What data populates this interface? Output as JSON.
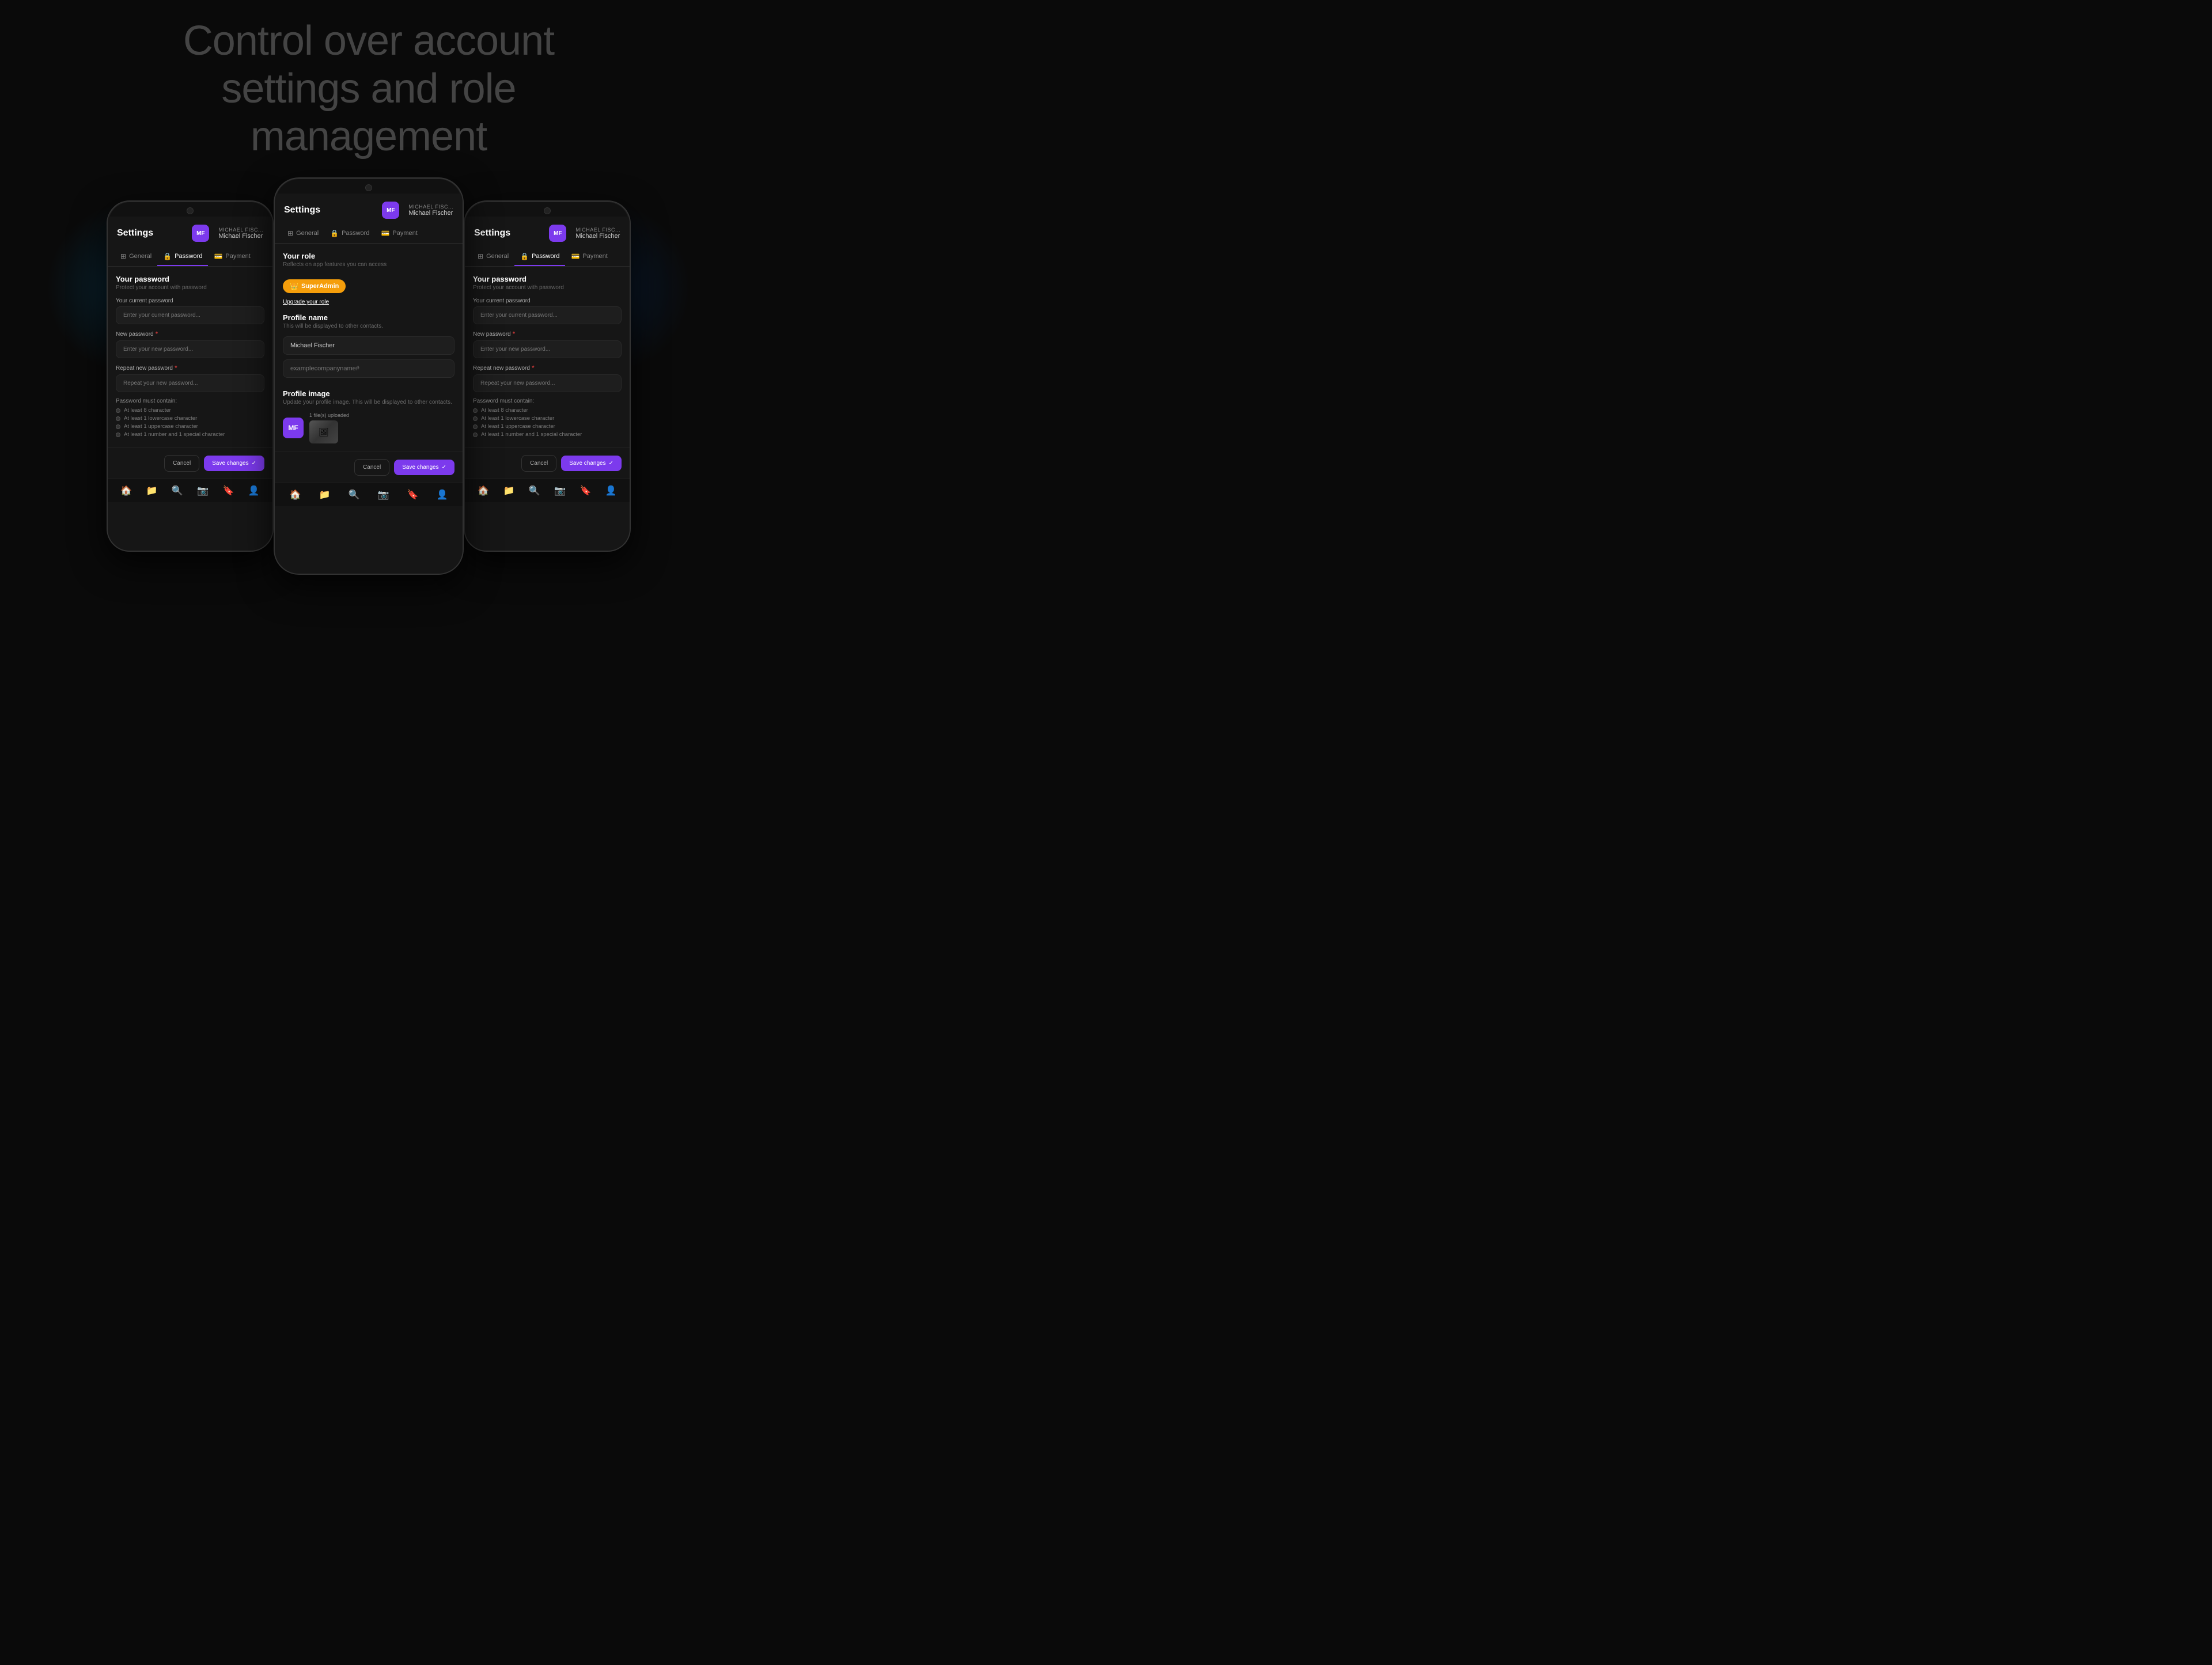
{
  "page": {
    "background": "#0a0a0a",
    "hero": {
      "line1": "Control over account",
      "line2": "settings and role",
      "line3": "management"
    }
  },
  "phones": {
    "left": {
      "header": {
        "title": "Settings",
        "avatar_initials": "MF",
        "user_name_top": "MICHAEL FISC...",
        "user_name_bottom": "Michael Fischer"
      },
      "tabs": [
        {
          "label": "General",
          "icon": "⊞",
          "active": false
        },
        {
          "label": "Password",
          "icon": "🔒",
          "active": true
        },
        {
          "label": "Payment",
          "icon": "💳",
          "active": false
        }
      ],
      "password_section": {
        "title": "Your password",
        "subtitle": "Protect your account with password",
        "fields": [
          {
            "label": "Your current password",
            "required": false,
            "placeholder": "Enter your current password..."
          },
          {
            "label": "New password",
            "required": true,
            "placeholder": "Enter your new password..."
          },
          {
            "label": "Repeat new password",
            "required": true,
            "placeholder": "Repeat your new password..."
          }
        ],
        "rules_title": "Password must contain:",
        "rules": [
          {
            "label": "At least 8 character",
            "checked": false
          },
          {
            "label": "At least 1 lowercase character",
            "checked": false
          },
          {
            "label": "At least 1 uppercase character",
            "checked": false
          },
          {
            "label": "At least 1 number and 1 special character",
            "checked": false
          }
        ]
      },
      "buttons": {
        "cancel": "Cancel",
        "save": "Save changes"
      },
      "bottom_nav": [
        "🏠",
        "📁",
        "🔍",
        "📷",
        "🔖",
        "👤"
      ]
    },
    "center": {
      "header": {
        "title": "Settings",
        "avatar_initials": "MF",
        "user_name_top": "MICHAEL FISC...",
        "user_name_bottom": "Michael Fischer"
      },
      "tabs": [
        {
          "label": "General",
          "icon": "⊞",
          "active": false
        },
        {
          "label": "Password",
          "icon": "🔒",
          "active": false
        },
        {
          "label": "Payment",
          "icon": "💳",
          "active": false
        }
      ],
      "role_section": {
        "title": "Your role",
        "subtitle": "Reflects on app features you can access",
        "role_label": "SuperAdmin",
        "upgrade_text": "Upgrade your role"
      },
      "profile_name_section": {
        "title": "Profile name",
        "subtitle": "This will be displayed to other contacts.",
        "name_value": "Michael Fischer",
        "company_placeholder": "examplecompanyname#"
      },
      "profile_image_section": {
        "title": "Profile image",
        "subtitle": "Update your profile image. This will be displayed to other contacts.",
        "files_uploaded": "1 file(s) uploaded",
        "avatar_initials": "MF"
      },
      "buttons": {
        "cancel": "Cancel",
        "save": "Save changes"
      },
      "bottom_nav": [
        "🏠",
        "📁",
        "🔍",
        "📷",
        "🔖",
        "👤"
      ]
    },
    "right": {
      "header": {
        "title": "Settings",
        "avatar_initials": "MF",
        "user_name_top": "MICHAEL FISC...",
        "user_name_bottom": "Michael Fischer"
      },
      "tabs": [
        {
          "label": "General",
          "icon": "⊞",
          "active": false
        },
        {
          "label": "Password",
          "icon": "🔒",
          "active": true
        },
        {
          "label": "Payment",
          "icon": "💳",
          "active": false
        }
      ],
      "password_section": {
        "title": "Your password",
        "subtitle": "Protect your account with password",
        "fields": [
          {
            "label": "Your current password",
            "required": false,
            "placeholder": "Enter your current password..."
          },
          {
            "label": "New password",
            "required": true,
            "placeholder": "Enter your new password..."
          },
          {
            "label": "Repeat new password",
            "required": true,
            "placeholder": "Repeat your new password..."
          }
        ],
        "rules_title": "Password must contain:",
        "rules": [
          {
            "label": "At least 8 character",
            "checked": false
          },
          {
            "label": "At least 1 lowercase character",
            "checked": false
          },
          {
            "label": "At least 1 uppercase character",
            "checked": false
          },
          {
            "label": "At least 1 number and 1 special character",
            "checked": false
          }
        ]
      },
      "buttons": {
        "cancel": "Cancel",
        "save": "Save changes"
      },
      "bottom_nav": [
        "🏠",
        "📁",
        "🔍",
        "📷",
        "🔖",
        "👤"
      ]
    }
  }
}
